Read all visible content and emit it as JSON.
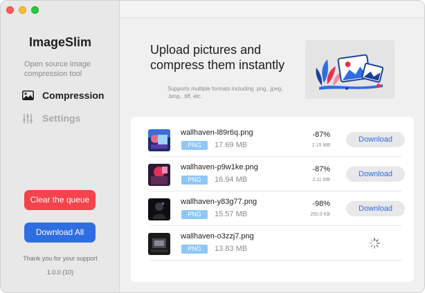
{
  "sidebar": {
    "app_title": "ImageSlim",
    "subtitle": "Open source image compression tool",
    "nav": [
      {
        "label": "Compression",
        "icon": "photo-icon",
        "active": true
      },
      {
        "label": "Settings",
        "icon": "sliders-icon",
        "active": false
      }
    ],
    "clear_label": "Clear the queue",
    "download_all_label": "Download All",
    "thanks": "Thank you for your support",
    "version": "1.0.0 (10)"
  },
  "upload": {
    "headline": "Upload pictures and compress them instantly",
    "formats": "Supports multiple formats including .png, .jpeg, .bmp, .tiff, etc.",
    "illustration": "upload-illustration"
  },
  "files": [
    {
      "name": "wallhaven-l89r6q.png",
      "format": "PNG",
      "original_size": "17.69 MB",
      "reduction": "-87%",
      "new_size": "2.15 MB",
      "action": "Download",
      "status": "done"
    },
    {
      "name": "wallhaven-p9w1ke.png",
      "format": "PNG",
      "original_size": "16.94 MB",
      "reduction": "-87%",
      "new_size": "2.11 MB",
      "action": "Download",
      "status": "done"
    },
    {
      "name": "wallhaven-y83g77.png",
      "format": "PNG",
      "original_size": "15.57 MB",
      "reduction": "-98%",
      "new_size": "250.0 KB",
      "action": "Download",
      "status": "done"
    },
    {
      "name": "wallhaven-o3zzj7.png",
      "format": "PNG",
      "original_size": "13.83 MB",
      "reduction": "",
      "new_size": "",
      "action": "",
      "status": "processing"
    }
  ],
  "colors": {
    "accent": "#2f6de3",
    "danger": "#f4434c",
    "badge": "#8fc7f5"
  }
}
